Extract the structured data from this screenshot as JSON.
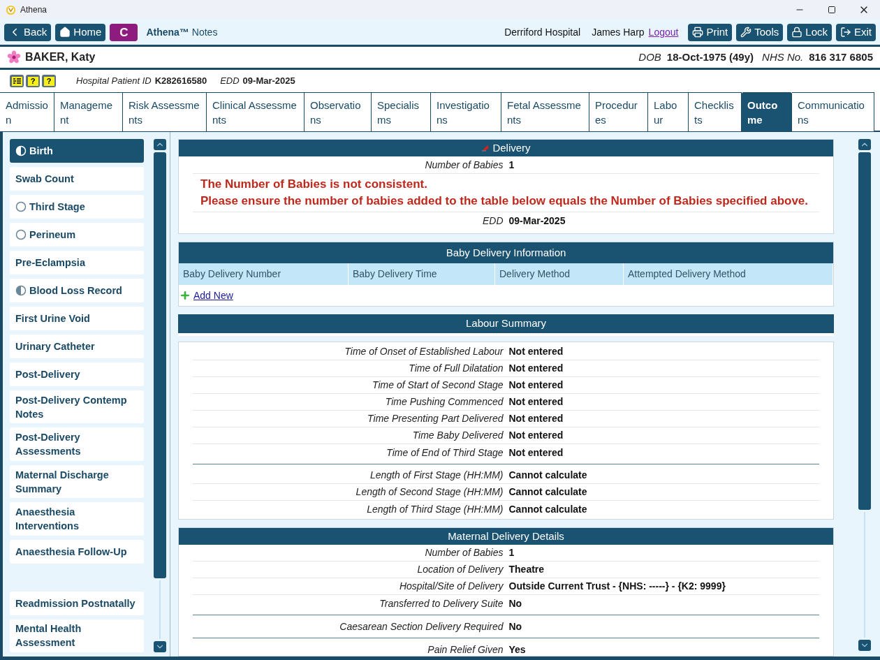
{
  "window": {
    "title": "Athena"
  },
  "toolbar": {
    "back": "Back",
    "home": "Home",
    "c_button": "C",
    "app_name": "Athena™",
    "app_sub": "Notes",
    "hospital": "Derriford Hospital",
    "user": "James Harp",
    "logout": "Logout",
    "buttons": [
      {
        "kind": "print",
        "label": "Print"
      },
      {
        "kind": "tools",
        "label": "Tools"
      },
      {
        "kind": "lock",
        "label": "Lock"
      },
      {
        "kind": "exit",
        "label": "Exit"
      }
    ]
  },
  "patient": {
    "name": "BAKER, Katy",
    "dob_label": "DOB",
    "dob": "18-Oct-1975 (49y)",
    "nhs_label": "NHS No.",
    "nhs": "816 317 6805"
  },
  "info": {
    "badges": [
      {
        "kind": "list"
      },
      {
        "kind": "home",
        "symbol": "?"
      },
      {
        "kind": "plain",
        "symbol": "?"
      }
    ],
    "id_label": "Hospital Patient ID",
    "id": "K282616580",
    "edd_label": "EDD",
    "edd": "09-Mar-2025"
  },
  "tabs": [
    {
      "label": "Admission",
      "selected": false
    },
    {
      "label": "Management",
      "selected": false
    },
    {
      "label": "Risk Assessments",
      "selected": false
    },
    {
      "label": "Clinical Assessments",
      "selected": false
    },
    {
      "label": "Observations",
      "selected": false
    },
    {
      "label": "Specialisms",
      "selected": false
    },
    {
      "label": "Investigations",
      "selected": false
    },
    {
      "label": "Fetal Assessments",
      "selected": false
    },
    {
      "label": "Procedures",
      "selected": false
    },
    {
      "label": "Labour",
      "selected": false
    },
    {
      "label": "Checklists",
      "selected": false
    },
    {
      "label": "Outcome",
      "selected": true
    },
    {
      "label": "Communications",
      "selected": false
    }
  ],
  "sidebar": {
    "items": [
      {
        "label": "Birth",
        "selected": true,
        "kind": "partial"
      },
      {
        "label": "Swab Count",
        "selected": false,
        "kind": "plain"
      },
      {
        "label": "Third Stage",
        "selected": false,
        "kind": "empty"
      },
      {
        "label": "Perineum",
        "selected": false,
        "kind": "empty"
      },
      {
        "label": "Pre-Eclampsia",
        "selected": false,
        "kind": "plain"
      },
      {
        "label": "Blood Loss Record",
        "selected": false,
        "kind": "partial"
      },
      {
        "label": "First Urine Void",
        "selected": false,
        "kind": "plain"
      },
      {
        "label": "Urinary Catheter",
        "selected": false,
        "kind": "plain"
      },
      {
        "label": "Post-Delivery",
        "selected": false,
        "kind": "plain"
      },
      {
        "label": "Post-Delivery Contemp Notes",
        "selected": false,
        "kind": "plain"
      },
      {
        "label": "Post-Delivery Assessments",
        "selected": false,
        "kind": "plain"
      },
      {
        "label": "Maternal Discharge Summary",
        "selected": false,
        "kind": "plain"
      },
      {
        "label": "Anaesthesia Interventions",
        "selected": false,
        "kind": "plain"
      },
      {
        "label": "Anaesthesia Follow-Up",
        "selected": false,
        "kind": "plain"
      },
      {
        "label": "Readmission Postnatally",
        "selected": false,
        "kind": "plain",
        "group_start": true
      },
      {
        "label": "Mental Health Assessment",
        "selected": false,
        "kind": "plain"
      }
    ]
  },
  "delivery": {
    "title": "Delivery",
    "rows_before": [
      {
        "label": "Number of Babies",
        "value": "1"
      }
    ],
    "errors": [
      "The Number of Babies is not consistent.",
      "Please ensure the number of babies added to the table below equals the Number of Babies specified above."
    ],
    "rows_after": [
      {
        "label": "EDD",
        "value": "09-Mar-2025"
      }
    ]
  },
  "baby_table": {
    "title": "Baby Delivery Information",
    "columns": [
      "Baby Delivery Number",
      "Baby Delivery Time",
      "Delivery Method",
      "Attempted Delivery Method"
    ],
    "add_new": "Add New"
  },
  "labour_summary": {
    "title": "Labour Summary",
    "groups": [
      [
        {
          "label": "Time of Onset of Established Labour",
          "value": "Not entered"
        },
        {
          "label": "Time of Full Dilatation",
          "value": "Not entered"
        },
        {
          "label": "Time of Start of Second Stage",
          "value": "Not entered"
        },
        {
          "label": "Time Pushing Commenced",
          "value": "Not entered"
        },
        {
          "label": "Time Presenting Part Delivered",
          "value": "Not entered"
        },
        {
          "label": "Time Baby Delivered",
          "value": "Not entered"
        },
        {
          "label": "Time of End of Third Stage",
          "value": "Not entered"
        }
      ],
      [
        {
          "label": "Length of First Stage (HH:MM)",
          "value": "Cannot calculate"
        },
        {
          "label": "Length of Second Stage (HH:MM)",
          "value": "Cannot calculate"
        },
        {
          "label": "Length of Third Stage (HH:MM)",
          "value": "Cannot calculate"
        }
      ]
    ]
  },
  "maternal_details": {
    "title": "Maternal Delivery Details",
    "groups": [
      [
        {
          "label": "Number of Babies",
          "value": "1"
        },
        {
          "label": "Location of Delivery",
          "value": "Theatre"
        },
        {
          "label": "Hospital/Site of Delivery",
          "value": "Outside Current Trust - {NHS: -----} - {K2: 9999}"
        },
        {
          "label": "Transferred to Delivery Suite",
          "value": "No"
        }
      ],
      [
        {
          "label": "Caesarean Section Delivery Required",
          "value": "No"
        }
      ],
      [
        {
          "label": "Pain Relief Given",
          "value": "Yes"
        }
      ]
    ]
  }
}
